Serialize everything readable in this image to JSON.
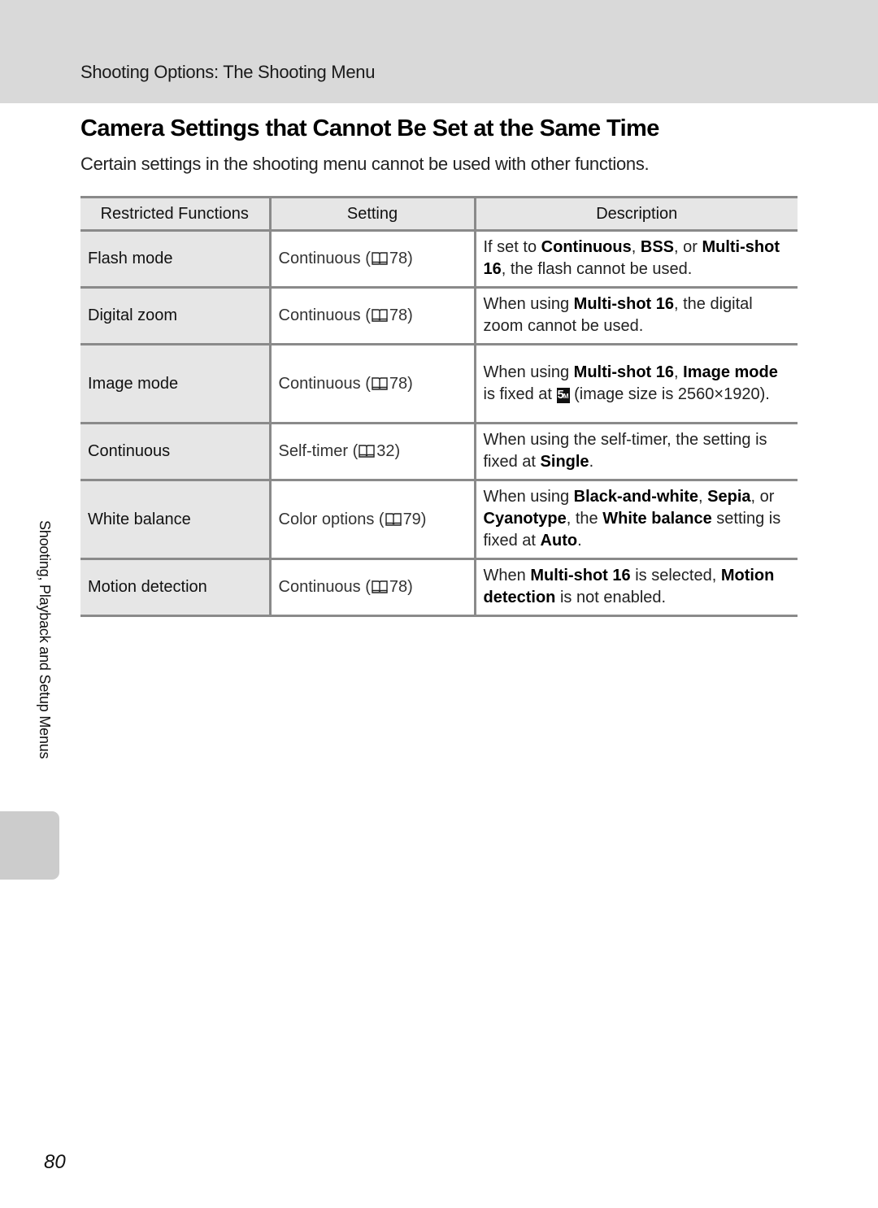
{
  "header": {
    "section_label": "Shooting Options: The Shooting Menu",
    "band_color": "#d9d9d9"
  },
  "title": "Camera Settings that Cannot Be Set at the Same Time",
  "intro": "Certain settings in the shooting menu cannot be used with other functions.",
  "table": {
    "columns": [
      "Restricted Functions",
      "Setting",
      "Description"
    ],
    "rows": [
      {
        "function": "Flash mode",
        "setting": "Continuous (",
        "page_ref": "78)",
        "description": [
          {
            "t": "If set to "
          },
          {
            "t": "Continuous",
            "b": true
          },
          {
            "t": ", "
          },
          {
            "t": "BSS",
            "b": true
          },
          {
            "t": ", or "
          },
          {
            "t": "Multi-shot 16",
            "b": true
          },
          {
            "t": ", the flash cannot be used."
          }
        ]
      },
      {
        "function": "Digital zoom",
        "setting": "Continuous (",
        "page_ref": "78)",
        "description": [
          {
            "t": "When using "
          },
          {
            "t": "Multi-shot 16",
            "b": true
          },
          {
            "t": ", the digital zoom cannot be used."
          }
        ]
      },
      {
        "function": "Image mode",
        "setting": "Continuous (",
        "page_ref": "78)",
        "description": [
          {
            "t": "When using "
          },
          {
            "t": "Multi-shot 16",
            "b": true
          },
          {
            "t": ", "
          },
          {
            "t": "Image mode",
            "b": true
          },
          {
            "t": " is fixed at "
          },
          {
            "icon": "5m-image-size-icon"
          },
          {
            "t": " (image size is 2560×1920)."
          }
        ]
      },
      {
        "function": "Continuous",
        "setting": "Self-timer (",
        "page_ref": "32)",
        "description": [
          {
            "t": "When using the self-timer, the setting is fixed at "
          },
          {
            "t": "Single",
            "b": true
          },
          {
            "t": "."
          }
        ]
      },
      {
        "function": "White balance",
        "setting": "Color options (",
        "page_ref": "79)",
        "description": [
          {
            "t": "When using "
          },
          {
            "t": "Black-and-white",
            "b": true
          },
          {
            "t": ", "
          },
          {
            "t": "Sepia",
            "b": true
          },
          {
            "t": ", or "
          },
          {
            "t": "Cyanotype",
            "b": true
          },
          {
            "t": ", the "
          },
          {
            "t": "White balance",
            "b": true
          },
          {
            "t": " setting is fixed at "
          },
          {
            "t": "Auto",
            "b": true
          },
          {
            "t": "."
          }
        ]
      },
      {
        "function": "Motion detection",
        "setting": "Continuous (",
        "page_ref": "78)",
        "description": [
          {
            "t": "When "
          },
          {
            "t": "Multi-shot 16",
            "b": true
          },
          {
            "t": " is selected, "
          },
          {
            "t": "Motion detection",
            "b": true
          },
          {
            "t": " is not enabled."
          }
        ]
      }
    ],
    "icon_5m": {
      "main": "5",
      "sub": "M"
    }
  },
  "side_tab": {
    "label": "Shooting, Playback and Setup Menus",
    "color": "#cccccc"
  },
  "page_number": "80"
}
